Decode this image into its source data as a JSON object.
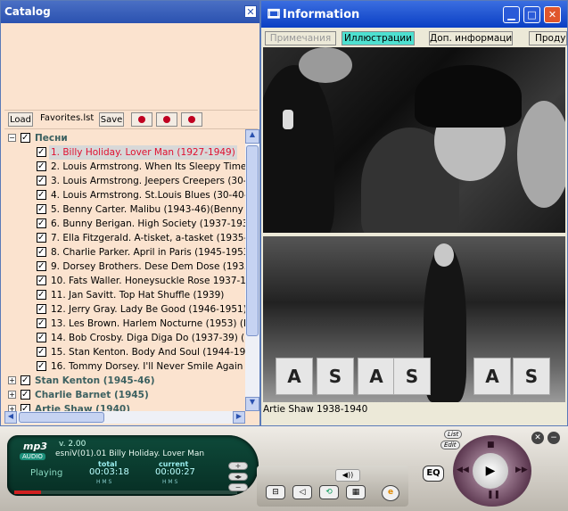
{
  "catalog": {
    "title": "Catalog",
    "toolbar": {
      "load_label": "Load",
      "playlist_name": "Favorites.lst",
      "save_label": "Save"
    },
    "root_group": "Песни",
    "tracks": [
      "1. Billy Holiday. Lover Man (1927-1949)",
      "2. Louis Armstrong. When Its Sleepy Time Do",
      "3. Louis Armstrong. Jeepers Creepers (30-40",
      "4. Louis Armstrong. St.Louis Blues (30-40-e)",
      "5. Benny Carter. Malibu (1943-46)(Benny Car",
      "6. Bunny Berigan. High Society (1937-1939) r",
      "7. Ella Fitzgerald. A-tisket, a-tasket (1935-39)",
      "8. Charlie Parker. April in Paris (1945-1953)(V",
      "9. Dorsey Brothers. Dese Dem Dose (1935) (",
      "10. Fats Waller. Honeysuckle Rose 1937-1",
      "11. Jan Savitt. Top Hat Shuffle (1939)",
      "12. Jerry Gray. Lady Be Good (1946-1951) (",
      "13. Les Brown. Harlem Nocturne (1953) (Ear",
      "14. Bob Crosby. Diga Diga Do (1937-39) (Dor",
      "15. Stan Kenton. Body And Soul (1944-1945)",
      "16. Tommy Dorsey. I'll Never Smile Again (194"
    ],
    "other_groups": [
      "Stan Kenton (1945-46)",
      "Charlie Barnet (1945)",
      "Artie Shaw (1940)"
    ]
  },
  "info": {
    "title": "Information",
    "tabs": [
      "Примечания",
      "Иллюстрации",
      "Доп. информация",
      "Проду"
    ],
    "active_tab": "Иллюстрации",
    "caption": "Artie Shaw 1938-1940",
    "stand_letters": [
      "A",
      "S",
      "A",
      "S",
      "A",
      "S"
    ]
  },
  "player": {
    "logo": "mp3",
    "logo_sub": "AUDIO",
    "version": "v. 2.00",
    "now_playing": "esniV(01).01 Billy Holiday. Lover Man",
    "status": "Playing",
    "total_label": "total",
    "current_label": "current",
    "total_time": "00:03:18",
    "current_time": "00:00:27",
    "hms": "H   M   S",
    "eq_label": "EQ",
    "list_label": "List",
    "edit_label": "Edit"
  }
}
